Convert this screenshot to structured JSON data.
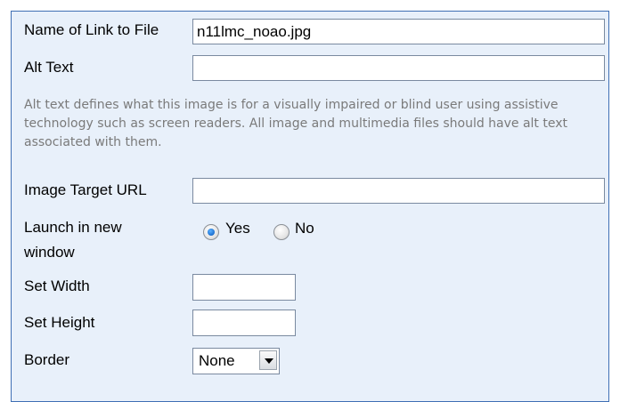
{
  "form": {
    "link_name": {
      "label": "Name of Link to File",
      "value": "n11lmc_noao.jpg"
    },
    "alt_text": {
      "label": "Alt Text",
      "value": ""
    },
    "alt_help": "Alt text defines what this image is for a visually impaired or blind user using assistive technology such as screen readers. All image and multimedia files should have alt text associated with them.",
    "target_url": {
      "label": "Image Target URL",
      "value": ""
    },
    "launch_new_window": {
      "label_line1": "Launch in new",
      "label_line2": "window",
      "options": [
        "Yes",
        "No"
      ],
      "selected": "Yes"
    },
    "width": {
      "label": "Set Width",
      "value": ""
    },
    "height": {
      "label": "Set Height",
      "value": ""
    },
    "border": {
      "label": "Border",
      "selected": "None"
    }
  },
  "colors": {
    "panel_bg": "#e8f0fa",
    "panel_border": "#3f6fb4",
    "help_text": "#7a7a7a"
  }
}
